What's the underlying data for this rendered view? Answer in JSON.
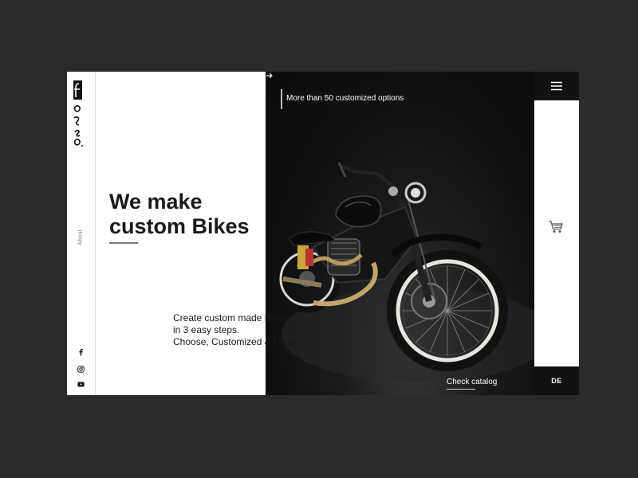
{
  "brand": {
    "logo_letters": "f o r e o"
  },
  "rail": {
    "about_label": "About",
    "social": [
      "facebook-icon",
      "instagram-icon",
      "youtube-icon"
    ]
  },
  "hero": {
    "headline_line1": "We make",
    "headline_line2": "custom Bikes",
    "desc_line1": "Create custom made Bikes",
    "desc_line2": "in 3 easy steps.",
    "desc_line3": "Choose, Customized & Order"
  },
  "photo": {
    "tagline": "More than 50 customized options",
    "catalog_label": "Check catalog",
    "catalog_icon": "arrow-right-icon"
  },
  "right": {
    "menu_icon": "hamburger-menu-icon",
    "cart_icon": "cart-icon",
    "language": "DE"
  },
  "colors": {
    "page_bg": "#2b2b2b",
    "panel_bg": "#ffffff",
    "dark_block": "#111111",
    "text_dark": "#1a1a1a"
  }
}
